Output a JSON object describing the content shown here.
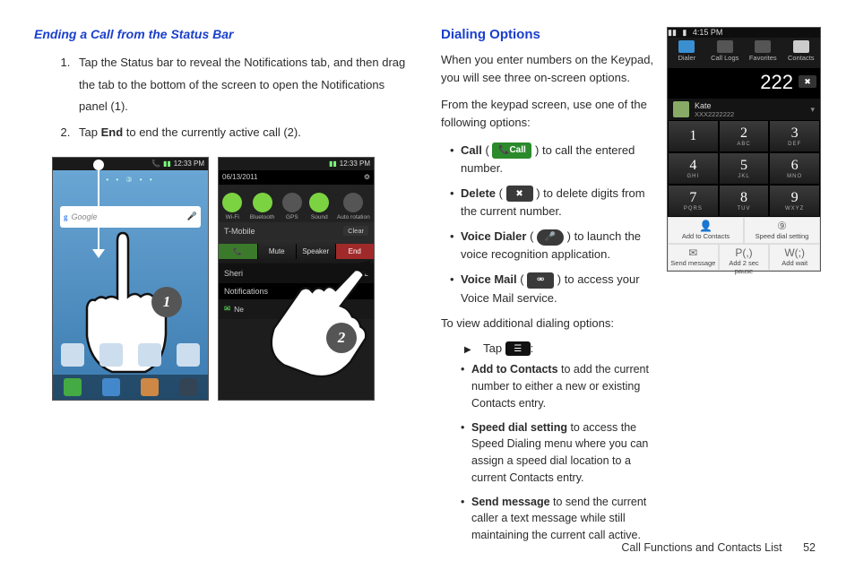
{
  "left": {
    "heading": "Ending a Call from the Status Bar",
    "step1": "Tap the Status bar to reveal the Notifications tab, and then drag the tab to the bottom of the screen to open the Notifications panel (1).",
    "step2_a": "Tap ",
    "step2_b": "End",
    "step2_c": " to end the currently active call (2).",
    "phone_time": "12:33 PM",
    "phone1_search": "Google",
    "phone1_dock": [
      "Phone",
      "Contacts",
      "Messaging",
      "Applications"
    ],
    "phone2_date": "06/13/2011",
    "phone2_toggles": [
      "Wi-Fi",
      "Bluetooth",
      "GPS",
      "Sound",
      "Auto rotation"
    ],
    "phone2_carrier": "T-Mobile",
    "phone2_clear": "Clear",
    "phone2_callbtns": [
      "",
      "Mute",
      "Speaker",
      "End"
    ],
    "phone2_name": "Sheri",
    "phone2_timer": "00:2",
    "phone2_notif": "Notifications",
    "phone2_row": "Ne",
    "circle1": "1",
    "circle2": "2"
  },
  "right": {
    "heading": "Dialing Options",
    "p1": "When you enter numbers on the Keypad, you will see three on-screen options.",
    "p2": "From the keypad screen, use one of the following options:",
    "call_lbl": "Call",
    "call_a": "Call",
    "call_b": " to call the entered number.",
    "del_a": "Delete",
    "del_b": " to delete digits from the current number.",
    "vd_a": "Voice Dialer",
    "vd_b": " to launch the voice recognition application.",
    "vm_a": "Voice Mail",
    "vm_b": " to access your Voice Mail service.",
    "p3": "To view additional dialing options:",
    "tap": "Tap ",
    "add_a": "Add to Contacts",
    "add_b": " to add the current number to either a new or existing Contacts entry.",
    "spd_a": "Speed dial setting",
    "spd_b": " to access the Speed Dialing menu where you can assign a speed dial location to a current Contacts entry.",
    "msg_a": "Send message",
    "msg_b": " to send the current caller a text message while still maintaining the current call active."
  },
  "dialer": {
    "time": "4:15 PM",
    "tabs": [
      "Dialer",
      "Call Logs",
      "Favorites",
      "Contacts"
    ],
    "number": "222",
    "contact_name": "Kate",
    "contact_num": "XXX2222222",
    "keys": [
      {
        "d": "1",
        "l": ""
      },
      {
        "d": "2",
        "l": "ABC"
      },
      {
        "d": "3",
        "l": "DEF"
      },
      {
        "d": "4",
        "l": "GHI"
      },
      {
        "d": "5",
        "l": "JKL"
      },
      {
        "d": "6",
        "l": "MNO"
      },
      {
        "d": "7",
        "l": "PQRS"
      },
      {
        "d": "8",
        "l": "TUV"
      },
      {
        "d": "9",
        "l": "WXYZ"
      }
    ],
    "menu1": [
      {
        "i": "👤",
        "t": "Add to Contacts"
      },
      {
        "i": "⑨",
        "t": "Speed dial setting"
      }
    ],
    "menu2": [
      {
        "i": "✉",
        "t": "Send message"
      },
      {
        "i": "P(,)",
        "t": "Add 2 sec pause"
      },
      {
        "i": "W(;)",
        "t": "Add wait"
      }
    ]
  },
  "footer": {
    "section": "Call Functions and Contacts List",
    "page": "52"
  }
}
